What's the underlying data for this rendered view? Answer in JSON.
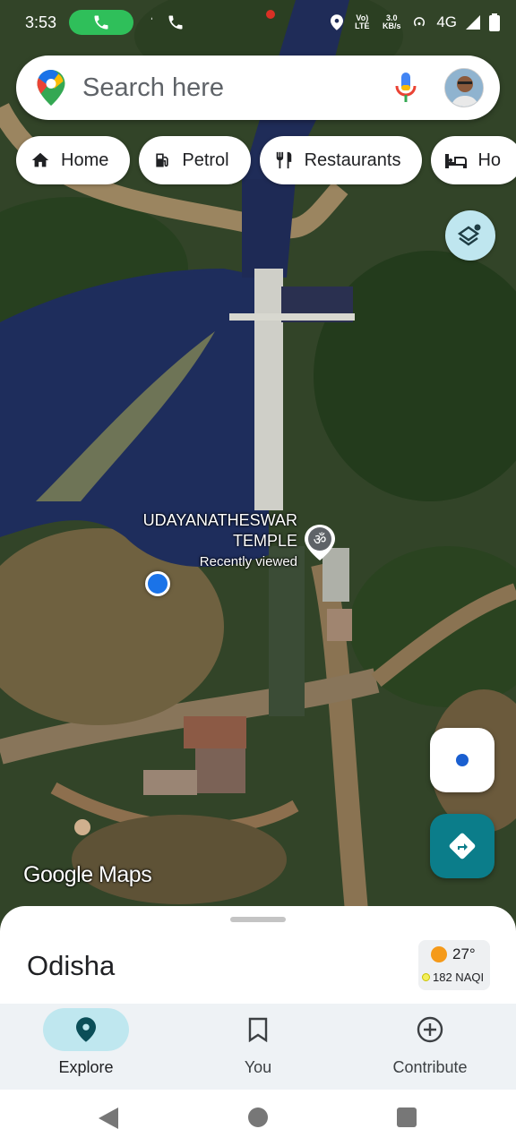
{
  "status_bar": {
    "time": "3:53",
    "network_label": "4G",
    "lte_label": "Vo) LTE",
    "speed_label": "3.0 KB/s"
  },
  "search": {
    "placeholder": "Search here"
  },
  "chips": [
    {
      "label": "Home",
      "icon": "home-icon"
    },
    {
      "label": "Petrol",
      "icon": "fuel-icon"
    },
    {
      "label": "Restaurants",
      "icon": "restaurant-icon"
    },
    {
      "label": "Ho",
      "icon": "hotel-icon"
    }
  ],
  "map": {
    "place_name_line1": "UDAYANATHESWAR",
    "place_name_line2": "TEMPLE",
    "place_sub": "Recently viewed",
    "watermark": "Google Maps"
  },
  "sheet": {
    "title": "Odisha",
    "temperature": "27°",
    "aqi": "182 NAQI"
  },
  "nav": {
    "explore": "Explore",
    "you": "You",
    "contribute": "Contribute"
  },
  "colors": {
    "accent_teal": "#0b7d8a",
    "pill_active": "#bfe7ef",
    "location_blue": "#1a73e8",
    "call_green": "#2fbf5a"
  }
}
